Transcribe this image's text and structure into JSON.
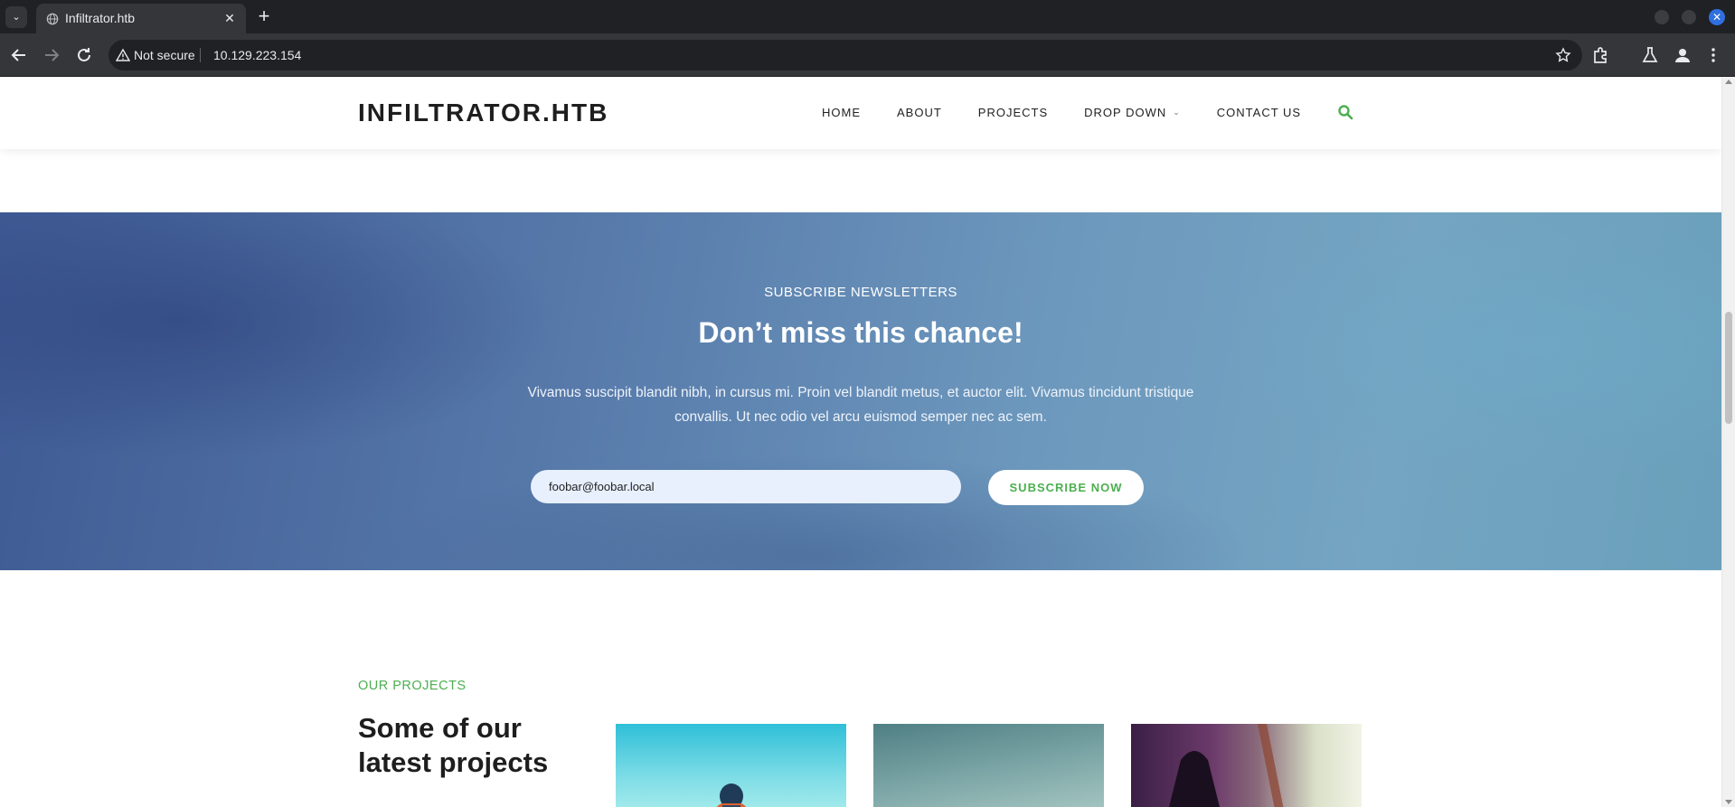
{
  "browser": {
    "tab_title": "Infiltrator.htb",
    "security_label": "Not secure",
    "url": "10.129.223.154"
  },
  "site": {
    "logo": "INFILTRATOR.HTB",
    "nav": [
      "HOME",
      "ABOUT",
      "PROJECTS",
      "DROP DOWN",
      "CONTACT US"
    ],
    "accent_color": "#4caf50"
  },
  "newsletter": {
    "kicker": "SUBSCRIBE NEWSLETTERS",
    "title": "Don’t miss this chance!",
    "text": "Vivamus suscipit blandit nibh, in cursus mi. Proin vel blandit metus, et auctor elit. Vivamus tincidunt tristique convallis. Ut nec odio vel arcu euismod semper nec ac sem.",
    "email_value": "foobar@foobar.local",
    "button_label": "SUBSCRIBE NOW"
  },
  "projects": {
    "kicker": "OUR PROJECTS",
    "title": "Some of our latest projects"
  }
}
